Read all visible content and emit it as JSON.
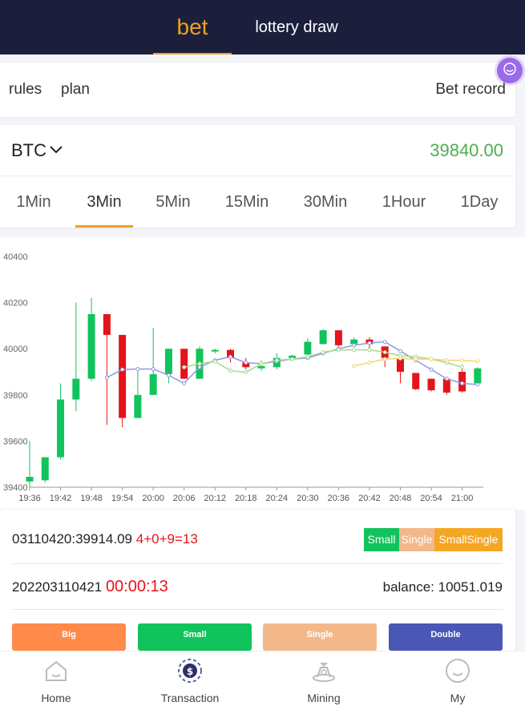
{
  "header": {
    "tabs": [
      {
        "label": "bet",
        "active": true
      },
      {
        "label": "lottery draw",
        "active": false
      }
    ],
    "accent": "#f0a11d",
    "background": "#1c1f3b"
  },
  "links": {
    "rules": "rules",
    "plan": "plan",
    "bet_record": "Bet record"
  },
  "coin": {
    "name": "BTC",
    "price": "39840.00",
    "price_color": "#4caf50"
  },
  "intervals": [
    {
      "label": "1Min"
    },
    {
      "label": "3Min",
      "active": true
    },
    {
      "label": "5Min"
    },
    {
      "label": "15Min"
    },
    {
      "label": "30Min"
    },
    {
      "label": "1Hour"
    },
    {
      "label": "1Day"
    }
  ],
  "chart_data": {
    "type": "candlestick",
    "y_ticks": [
      "40400",
      "40200",
      "40000",
      "39800",
      "39600",
      "39400"
    ],
    "ylim": [
      39400,
      40400
    ],
    "x_ticks": [
      "19:36",
      "19:42",
      "19:48",
      "19:54",
      "20:00",
      "20:06",
      "20:12",
      "20:18",
      "20:24",
      "20:30",
      "20:36",
      "20:42",
      "20:48",
      "20:54",
      "21:00"
    ],
    "up_color": "#11c35c",
    "down_color": "#e5141a",
    "candles": [
      {
        "t": "19:36",
        "o": 39425,
        "c": 39445,
        "h": 39600,
        "l": 39400
      },
      {
        "t": "19:39",
        "o": 39430,
        "c": 39530,
        "h": 39530,
        "l": 39420
      },
      {
        "t": "19:42",
        "o": 39530,
        "c": 39780,
        "h": 39850,
        "l": 39520
      },
      {
        "t": "19:45",
        "o": 39780,
        "c": 39870,
        "h": 40200,
        "l": 39730
      },
      {
        "t": "19:48",
        "o": 39870,
        "c": 40150,
        "h": 40220,
        "l": 39860
      },
      {
        "t": "19:51",
        "o": 40150,
        "c": 40060,
        "h": 40150,
        "l": 39670
      },
      {
        "t": "19:54",
        "o": 40060,
        "c": 39700,
        "h": 40060,
        "l": 39660
      },
      {
        "t": "19:57",
        "o": 39700,
        "c": 39800,
        "h": 39910,
        "l": 39700
      },
      {
        "t": "20:00",
        "o": 39800,
        "c": 39890,
        "h": 40090,
        "l": 39800
      },
      {
        "t": "20:03",
        "o": 39890,
        "c": 40000,
        "h": 40000,
        "l": 39850
      },
      {
        "t": "20:06",
        "o": 40000,
        "c": 39870,
        "h": 40000,
        "l": 39870
      },
      {
        "t": "20:09",
        "o": 39870,
        "c": 40000,
        "h": 40010,
        "l": 39870
      },
      {
        "t": "20:12",
        "o": 39990,
        "c": 39995,
        "h": 40000,
        "l": 39980
      },
      {
        "t": "20:15",
        "o": 39995,
        "c": 39960,
        "h": 40000,
        "l": 39940
      },
      {
        "t": "20:18",
        "o": 39940,
        "c": 39920,
        "h": 39960,
        "l": 39910
      },
      {
        "t": "20:21",
        "o": 39915,
        "c": 39925,
        "h": 39950,
        "l": 39905
      },
      {
        "t": "20:24",
        "o": 39920,
        "c": 39960,
        "h": 39980,
        "l": 39910
      },
      {
        "t": "20:27",
        "o": 39960,
        "c": 39970,
        "h": 39975,
        "l": 39955
      },
      {
        "t": "20:30",
        "o": 39975,
        "c": 40030,
        "h": 40045,
        "l": 39965
      },
      {
        "t": "20:33",
        "o": 40020,
        "c": 40080,
        "h": 40085,
        "l": 40020
      },
      {
        "t": "20:36",
        "o": 40080,
        "c": 40015,
        "h": 40080,
        "l": 40010
      },
      {
        "t": "20:39",
        "o": 40020,
        "c": 40040,
        "h": 40050,
        "l": 40015
      },
      {
        "t": "20:42",
        "o": 40040,
        "c": 40020,
        "h": 40050,
        "l": 40000
      },
      {
        "t": "20:45",
        "o": 40010,
        "c": 39960,
        "h": 40010,
        "l": 39920
      },
      {
        "t": "20:48",
        "o": 39960,
        "c": 39900,
        "h": 39960,
        "l": 39850
      },
      {
        "t": "20:51",
        "o": 39895,
        "c": 39825,
        "h": 39895,
        "l": 39820
      },
      {
        "t": "20:54",
        "o": 39870,
        "c": 39820,
        "h": 39870,
        "l": 39815
      },
      {
        "t": "20:57",
        "o": 39870,
        "c": 39810,
        "h": 39875,
        "l": 39800
      },
      {
        "t": "21:00",
        "o": 39900,
        "c": 39815,
        "h": 39930,
        "l": 39810
      },
      {
        "t": "21:03",
        "o": 39850,
        "c": 39915,
        "h": 39920,
        "l": 39840
      }
    ],
    "ma_lines": [
      {
        "color": "#8e9be0",
        "start": 5,
        "values": [
          39875,
          39910,
          39912,
          39912,
          39885,
          39850,
          39920,
          39950,
          39965,
          39940,
          39935,
          39945,
          39955,
          39960,
          39980,
          40000,
          40015,
          40025,
          40030,
          39990,
          39950,
          39910,
          39870,
          39850,
          39845
        ]
      },
      {
        "color": "#a6d98b",
        "start": 10,
        "values": [
          39920,
          39935,
          39945,
          39905,
          39898,
          39935,
          39950,
          39955,
          39965,
          39985,
          39995,
          39995,
          39995,
          39985,
          39970,
          39965,
          39955,
          39940,
          39920
        ]
      },
      {
        "color": "#f5d36a",
        "start": 21,
        "values": [
          39925,
          39940,
          39955,
          39958,
          39955,
          39955,
          39950,
          39950,
          39945
        ]
      }
    ]
  },
  "round": {
    "last_result": "03110420:39914.09",
    "last_sum": "4+0+9=13",
    "tags": [
      {
        "label": "Small",
        "color": "#11c35c"
      },
      {
        "label": "Single",
        "color": "#f3b88a"
      },
      {
        "label": "SmallSingle",
        "color": "#f5a623"
      }
    ],
    "period": "202203110421",
    "countdown": "00:00:13",
    "balance_label": "balance:",
    "balance": "10051.019"
  },
  "bet_buttons": [
    {
      "label": "Big",
      "color": "#ff8a4a"
    },
    {
      "label": "Small",
      "color": "#11c35c"
    },
    {
      "label": "Single",
      "color": "#f3b88a"
    },
    {
      "label": "Double",
      "color": "#4a57b5"
    }
  ],
  "bottom_nav": [
    {
      "label": "Home",
      "icon": "home-icon"
    },
    {
      "label": "Transaction",
      "icon": "transaction-icon",
      "active": true
    },
    {
      "label": "Mining",
      "icon": "mining-icon"
    },
    {
      "label": "My",
      "icon": "profile-icon"
    }
  ]
}
